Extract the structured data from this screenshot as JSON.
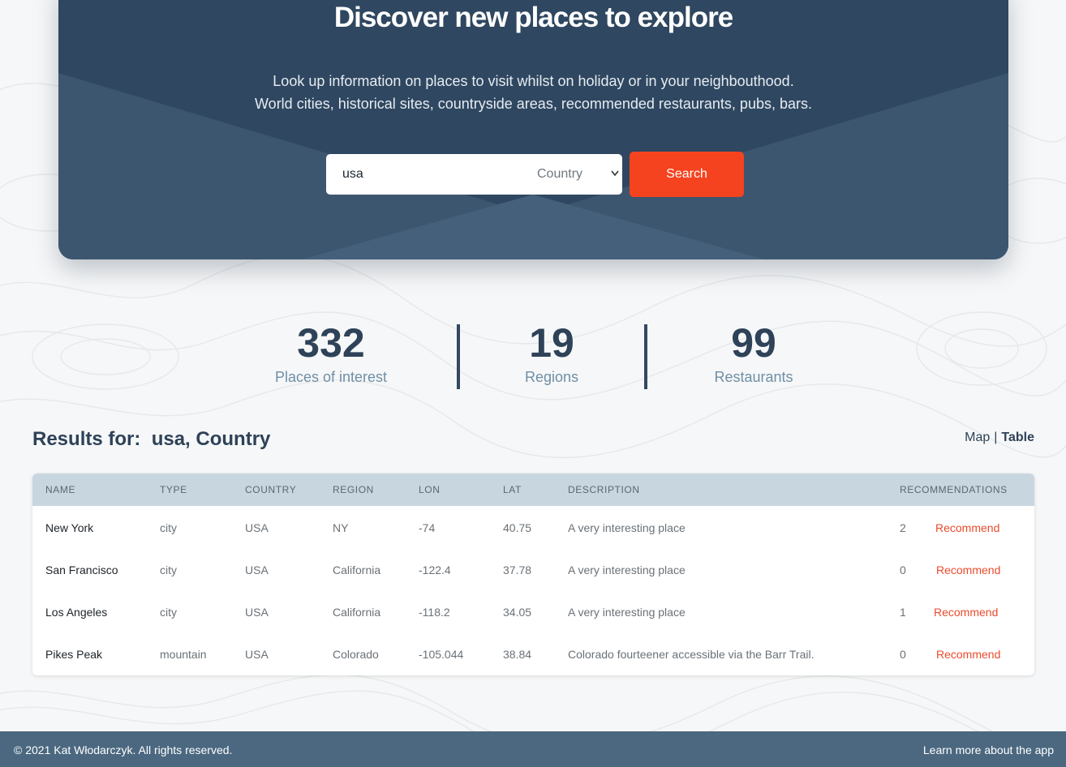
{
  "hero": {
    "title": "Discover new places to explore",
    "subtitle_line1": "Look up information on places to visit whilst on holiday or in your neighbouthood.",
    "subtitle_line2": "World cities, historical sites, countryside areas, recommended restaurants, pubs, bars."
  },
  "search": {
    "value": "usa",
    "selected_type": "Country",
    "button_label": "Search"
  },
  "stats": [
    {
      "value": "332",
      "label": "Places of interest"
    },
    {
      "value": "19",
      "label": "Regions"
    },
    {
      "value": "99",
      "label": "Restaurants"
    }
  ],
  "results": {
    "prefix": "Results for:",
    "query": "usa, Country"
  },
  "view_toggle": {
    "map": "Map",
    "separator": "|",
    "table": "Table",
    "active": "Table"
  },
  "table": {
    "headers": [
      "NAME",
      "TYPE",
      "COUNTRY",
      "REGION",
      "LON",
      "LAT",
      "DESCRIPTION",
      "RECOMMENDATIONS"
    ],
    "rows": [
      {
        "name": "New York",
        "type": "city",
        "country": "USA",
        "region": "NY",
        "lon": "-74",
        "lat": "40.75",
        "description": "A very interesting place",
        "recommendations": "2",
        "action": "Recommend"
      },
      {
        "name": "San Francisco",
        "type": "city",
        "country": "USA",
        "region": "California",
        "lon": "-122.4",
        "lat": "37.78",
        "description": "A very interesting place",
        "recommendations": "0",
        "action": "Recommend"
      },
      {
        "name": "Los Angeles",
        "type": "city",
        "country": "USA",
        "region": "California",
        "lon": "-118.2",
        "lat": "34.05",
        "description": "A very interesting place",
        "recommendations": "1",
        "action": "Recommend"
      },
      {
        "name": "Pikes Peak",
        "type": "mountain",
        "country": "USA",
        "region": "Colorado",
        "lon": "-105.044",
        "lat": "38.84",
        "description": "Colorado fourteener accessible via the Barr Trail.",
        "recommendations": "0",
        "action": "Recommend"
      }
    ]
  },
  "footer": {
    "copyright": "© 2021 Kat Włodarczyk. All rights reserved.",
    "learn_more": "Learn more about the app"
  },
  "colors": {
    "hero_bg": "#2f4760",
    "accent": "#f5431f",
    "table_header_bg": "#c8d6e0",
    "footer_bg": "#4b6880",
    "stat_label": "#6f8fa6"
  }
}
